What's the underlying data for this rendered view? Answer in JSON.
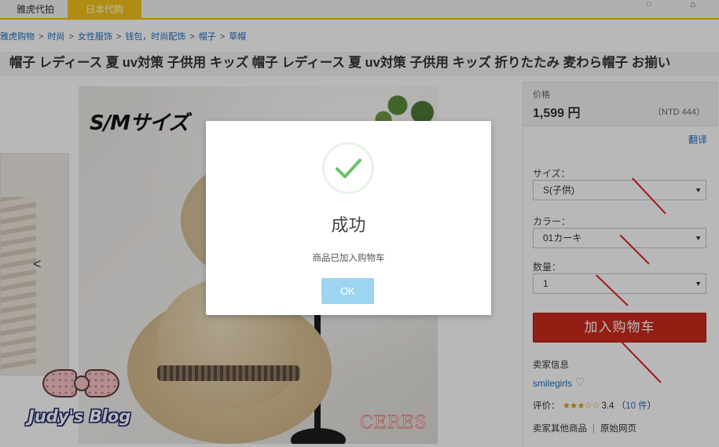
{
  "tabs": [
    {
      "label": "雅虎代拍"
    },
    {
      "label": "日本代购"
    }
  ],
  "breadcrumb": [
    "雅虎购物",
    "时尚",
    "女性服饰",
    "钱包，时尚配饰",
    "帽子",
    "草帽"
  ],
  "product": {
    "title": "帽子 レディース 夏 uv対策 子供用 キッズ 帽子 レディース 夏 uv対策 子供用 キッズ 折りたたみ 麦わら帽子 お揃い",
    "image_overlay_text": "S/Mサイズ",
    "image_brand": "CERES",
    "gallery_arrow": "<"
  },
  "blog_logo": {
    "text": "Judy's Blog"
  },
  "price": {
    "label": "价格",
    "value": "1,599 円",
    "ntd": "（NTD 444）"
  },
  "translate_label": "翻译",
  "options": {
    "size": {
      "label": "サイズ：",
      "value": "S(子供)"
    },
    "color": {
      "label": "カラー：",
      "value": "01カーキ"
    },
    "quantity": {
      "label": "数量：",
      "value": "1"
    }
  },
  "add_to_cart_label": "加入购物车",
  "seller": {
    "label": "卖家信息",
    "name": "smilegirls",
    "rating_label": "评价：",
    "stars_text": "★★★☆☆",
    "stars_value": 3.4,
    "score": "3.4",
    "count_open": "（",
    "count": "10 件",
    "count_close": "）"
  },
  "links": {
    "other_items": "卖家其他商品",
    "divider": "|",
    "original_page": "原始网页"
  },
  "modal": {
    "title": "成功",
    "message": "商品已加入购物车",
    "ok_label": "OK"
  },
  "colors": {
    "accent_tab": "#f6c31b",
    "cart_button": "#cc2a1c",
    "ok_button": "#9dd4ef",
    "success_check": "#6bc26b",
    "link": "#1e6fc2",
    "annotation_arrow": "#e42222"
  },
  "icons": [
    "check-icon",
    "heart-icon",
    "chevron-down-icon",
    "chevron-left-icon",
    "bow-icon"
  ]
}
